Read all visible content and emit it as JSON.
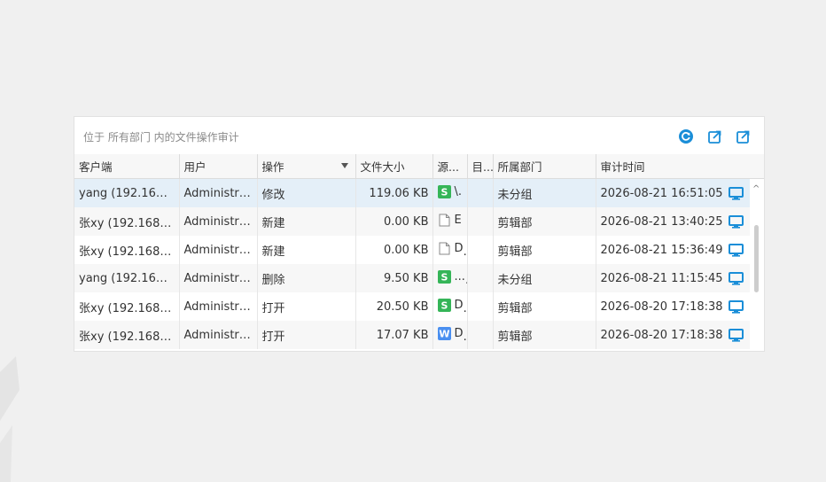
{
  "panel": {
    "title": "位于 所有部门 内的文件操作审计"
  },
  "header_icons": [
    "refresh-icon",
    "export-icon",
    "share-icon"
  ],
  "colors": {
    "accent": "#1a8ed8",
    "green": "#35b558",
    "word_blue": "#4a8ff0"
  },
  "columns": [
    "客户端",
    "用户",
    "操作",
    "文件大小",
    "源...",
    "目...",
    "所属部门",
    "审计时间"
  ],
  "rows": [
    {
      "client": "yang (192.168....",
      "user": "Administra...",
      "op": "修改",
      "size": "119.06 KB",
      "type": "green",
      "src": "\\.",
      "dst": "",
      "dept": "未分组",
      "time": "2026-08-21 16:51:05",
      "selected": true
    },
    {
      "client": "张xy (192.168.3...",
      "user": "Administra...",
      "op": "新建",
      "size": "0.00 KB",
      "type": "blank",
      "src": "E",
      "dst": "",
      "dept": "剪辑部",
      "time": "2026-08-21 13:40:25",
      "selected": false
    },
    {
      "client": "张xy (192.168.3...",
      "user": "Administra...",
      "op": "新建",
      "size": "0.00 KB",
      "type": "blank",
      "src": "D",
      "dst": "",
      "dept": "剪辑部",
      "time": "2026-08-21 15:36:49",
      "selected": false
    },
    {
      "client": "yang (192.168....",
      "user": "Administra...",
      "op": "删除",
      "size": "9.50 KB",
      "type": "green",
      "src": "...",
      "dst": "",
      "dept": "未分组",
      "time": "2026-08-21 11:15:45",
      "selected": false
    },
    {
      "client": "张xy (192.168.3...",
      "user": "Administra...",
      "op": "打开",
      "size": "20.50 KB",
      "type": "green",
      "src": "D",
      "dst": "",
      "dept": "剪辑部",
      "time": "2026-08-20 17:18:38",
      "selected": false
    },
    {
      "client": "张xy (192.168.3...",
      "user": "Administra...",
      "op": "打开",
      "size": "17.07 KB",
      "type": "word",
      "src": "D",
      "dst": "",
      "dept": "剪辑部",
      "time": "2026-08-20 17:18:38",
      "selected": false
    }
  ],
  "scroll": {
    "up": "^"
  },
  "icon_letters": {
    "green": "S",
    "word": "W"
  }
}
